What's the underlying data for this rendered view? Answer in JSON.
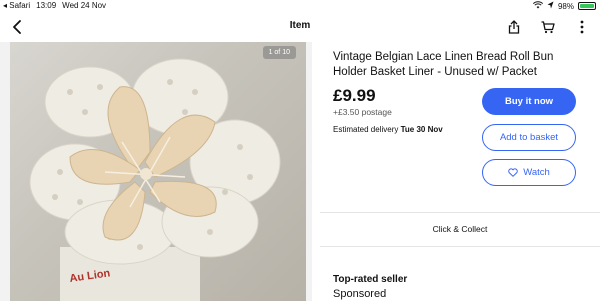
{
  "status_bar": {
    "back_app": "◂ Safari",
    "time": "13:09",
    "date": "Wed 24 Nov",
    "battery": "98%",
    "battery_level": 0.98
  },
  "nav": {
    "title": "Item",
    "back_icon": "chevron-left-icon",
    "share_icon": "share-icon",
    "cart_icon": "cart-icon",
    "more_icon": "more-icon"
  },
  "gallery": {
    "counter": "1 of 10"
  },
  "listing": {
    "title": "Vintage Belgian Lace Linen Bread Roll Bun Holder Basket Liner - Unused w/ Packet",
    "price": "£9.99",
    "postage": "+£3.50 postage",
    "delivery_label": "Estimated delivery",
    "delivery_date": "Tue 30 Nov"
  },
  "actions": {
    "buy_now": "Buy it now",
    "add_to_basket": "Add to basket",
    "watch": "Watch"
  },
  "click_collect": "Click & Collect",
  "seller": {
    "heading": "Top-rated seller",
    "sponsored": "Sponsored"
  },
  "colors": {
    "accent": "#3665f3",
    "battery": "#35c759"
  }
}
